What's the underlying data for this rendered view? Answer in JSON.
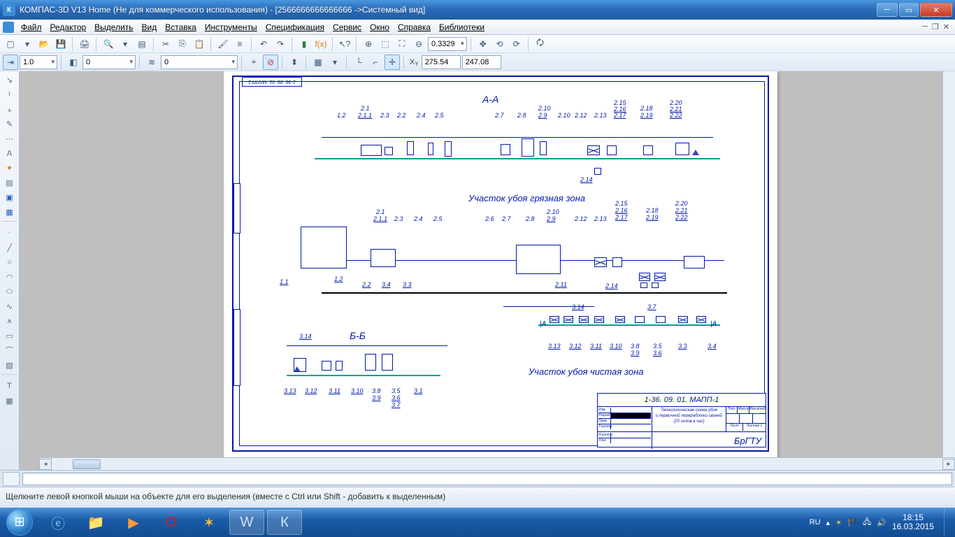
{
  "titlebar": {
    "title": "КОМПАС-3D V13 Home (Не для коммерческого использования) - [2566666666666666 ->Системный вид]"
  },
  "menu": {
    "file": "Файл",
    "edit": "Редактор",
    "select": "Выделить",
    "view": "Вид",
    "insert": "Вставка",
    "tools": "Инструменты",
    "spec": "Спецификация",
    "service": "Сервис",
    "window": "Окно",
    "help": "Справка",
    "libs": "Библиотеки"
  },
  "toolbar_row2": {
    "zoom_value": "0.3329",
    "x_label": "X",
    "x_value": "275.54",
    "y_label": "Y",
    "y_value": "247.08"
  },
  "toolbar_row3": {
    "size1": "1.0",
    "layer": "0",
    "style": "0"
  },
  "drawing": {
    "code_top": "1-36. 09. 01. МАПП-1",
    "section_aa": "А-А",
    "section_bb": "Б-Б",
    "zone_dirty": "Участок убоя грязная зона",
    "zone_clean": "Участок убоя чистая зона",
    "labels_top_row1": [
      "1.2",
      "2.1",
      "2.1.1",
      "2.3",
      "2.2",
      "2.4",
      "2.5",
      "2.7",
      "2.8",
      "2.10",
      "2.9",
      "2.10",
      "2.12",
      "2.13",
      "2.15",
      "2.16",
      "2.17",
      "2.18",
      "2.19",
      "2.20",
      "2.21",
      "2.22"
    ],
    "label_214": "2.14",
    "labels_mid": [
      "1.1",
      "1.2",
      "2.1",
      "2.1.1",
      "2.3",
      "2.4",
      "2.5",
      "2.2",
      "3.4",
      "3.3",
      "2.6",
      "2.7",
      "2.8",
      "2.10",
      "2.9",
      "2.12",
      "2.13",
      "2.11",
      "2.14",
      "2.15",
      "2.16",
      "2.17",
      "2.18",
      "2.19",
      "2.20",
      "2.21",
      "2.22"
    ],
    "labels_mid_lower": [
      "3.14",
      "3.7",
      "3.13",
      "3.12",
      "3.11",
      "3.10",
      "3.8",
      "3.9",
      "3.5",
      "3.6",
      "3.3",
      "3.4",
      "А",
      "А"
    ],
    "labels_bb": [
      "3.14",
      "3.13",
      "3.12",
      "3.11",
      "3.10",
      "3.8",
      "3.9",
      "3.5",
      "3.6",
      "3.7",
      "3.1"
    ],
    "titleblock": {
      "code": "1-36. 09. 01. МАПП-1",
      "desc1": "Технологическая схема убоя",
      "desc2": "и первичной переработки свиней",
      "desc3": "(25 голов в час)",
      "org": "БрГТУ",
      "lit": "Лит.",
      "mass": "Масса",
      "scale": "Масштаб",
      "sheet": "Лист",
      "sheets": "Листов 1",
      "izm": "Изм.",
      "razrab": "Разраб.",
      "prov": "Пров.",
      "tkontr": "Т.контр.",
      "nkontr": "Н.контр.",
      "utv": "Утв."
    }
  },
  "statusbar": {
    "hint": "Щелкните левой кнопкой мыши на объекте для его выделения (вместе с Ctrl или Shift - добавить к выделенным)"
  },
  "tray": {
    "lang": "RU",
    "time": "18:15",
    "date": "16.03.2015"
  }
}
